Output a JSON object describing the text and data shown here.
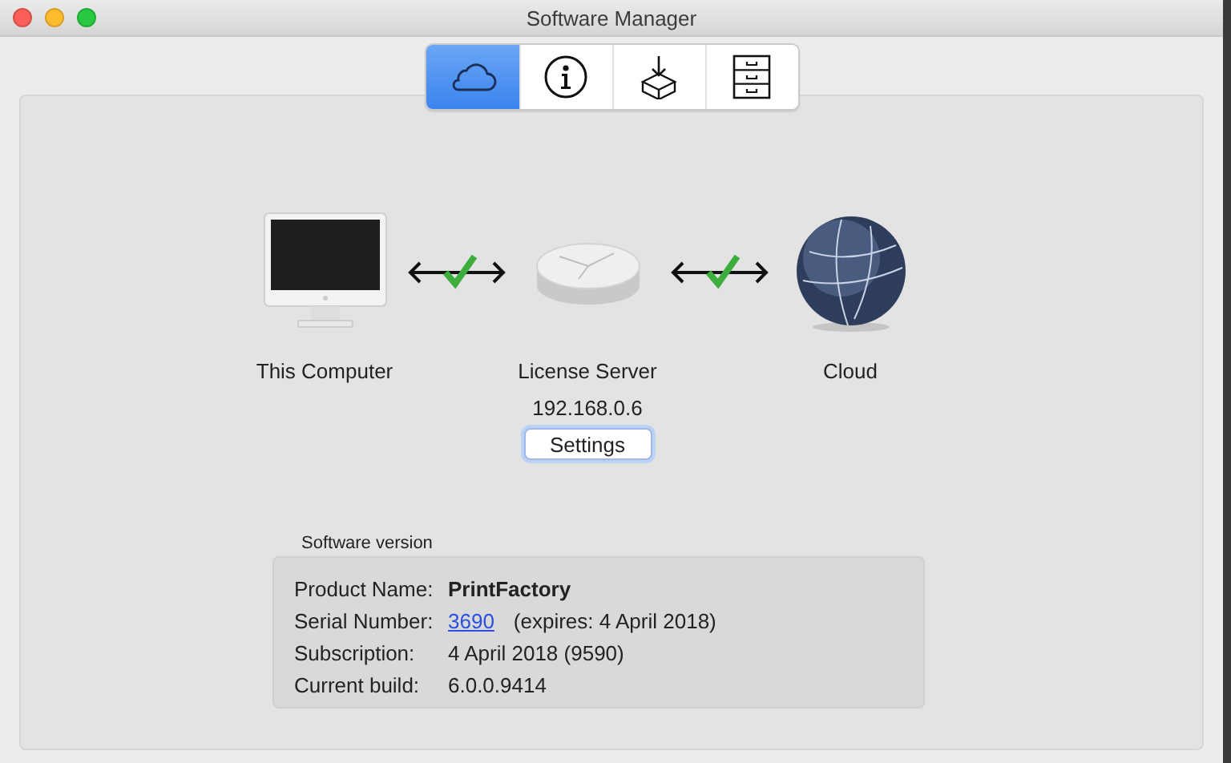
{
  "window": {
    "title": "Software Manager"
  },
  "tabs": [
    {
      "kind": "cloud",
      "selected": true
    },
    {
      "kind": "info",
      "selected": false
    },
    {
      "kind": "install",
      "selected": false
    },
    {
      "kind": "cabinet",
      "selected": false
    }
  ],
  "nodes": [
    {
      "kind": "computer",
      "label": "This Computer"
    },
    {
      "kind": "server",
      "label": "License Server",
      "address": "192.168.0.6",
      "button": "Settings"
    },
    {
      "kind": "globe",
      "label": "Cloud"
    }
  ],
  "connections": [
    {
      "connected": true
    },
    {
      "connected": true
    }
  ],
  "software_version": {
    "title": "Software version",
    "rows": [
      {
        "kind": "bold",
        "label": "Product Name:",
        "value": "PrintFactory"
      },
      {
        "kind": "link",
        "label": "Serial Number:",
        "link": "3690",
        "value": "(expires: 4 April 2018)"
      },
      {
        "kind": "plain",
        "label": "Subscription:",
        "value": "4 April 2018 (9590)"
      },
      {
        "kind": "plain",
        "label": "Current build:",
        "value": "6.0.0.9414"
      }
    ]
  }
}
